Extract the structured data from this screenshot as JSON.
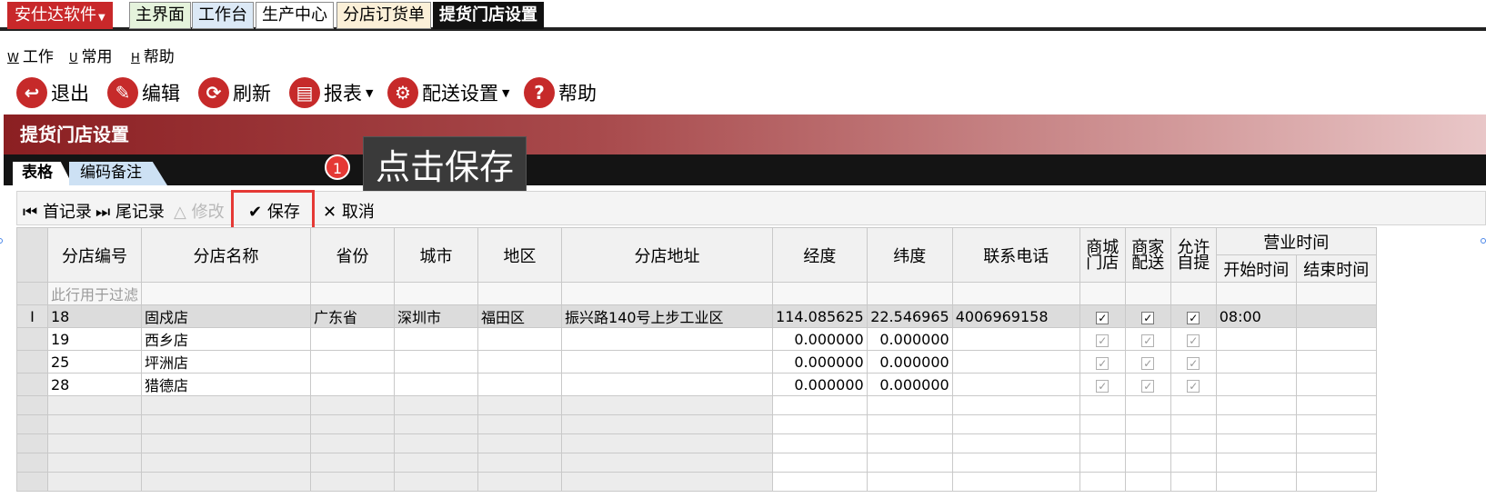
{
  "topbar": {
    "brand": "安仕达软件",
    "tabs": [
      "主界面",
      "工作台",
      "生产中心",
      "分店订货单",
      "提货门店设置"
    ]
  },
  "menubar": {
    "items": [
      {
        "key": "W",
        "label": "工作"
      },
      {
        "key": "U",
        "label": "常用"
      },
      {
        "key": "H",
        "label": "帮助"
      }
    ]
  },
  "toolbar": {
    "exit": "退出",
    "edit": "编辑",
    "refresh": "刷新",
    "report": "报表",
    "delivery": "配送设置",
    "help": "帮助"
  },
  "banner": {
    "title": "提货门店设置"
  },
  "subtabs": {
    "grid": "表格",
    "code_note": "编码备注"
  },
  "callout": {
    "badge": "1",
    "text": "点击保存"
  },
  "navbar": {
    "first": "首记录",
    "last": "尾记录",
    "modify": "修改",
    "save": "保存",
    "cancel": "取消"
  },
  "table": {
    "headers": {
      "code": "分店编号",
      "name": "分店名称",
      "province": "省份",
      "city": "城市",
      "district": "地区",
      "address": "分店地址",
      "lng": "经度",
      "lat": "纬度",
      "phone": "联系电话",
      "mall_a": "商城",
      "mall_b": "门店",
      "merchant_a": "商家",
      "merchant_b": "配送",
      "pickup_a": "允许",
      "pickup_b": "自提",
      "hours": "营业时间",
      "open": "开始时间",
      "close": "结束时间"
    },
    "filter_hint": "此行用于过滤",
    "rows": [
      {
        "code": "18",
        "name": "固戍店",
        "province": "广东省",
        "city": "深圳市",
        "district": "福田区",
        "address": "振兴路140号上步工业区",
        "lng": "114.085625",
        "lat": "22.546965",
        "phone": "4006969158",
        "open": "08:00",
        "close": ""
      },
      {
        "code": "19",
        "name": "西乡店",
        "province": "",
        "city": "",
        "district": "",
        "address": "",
        "lng": "0.000000",
        "lat": "0.000000",
        "phone": "",
        "open": "",
        "close": ""
      },
      {
        "code": "25",
        "name": "坪洲店",
        "province": "",
        "city": "",
        "district": "",
        "address": "",
        "lng": "0.000000",
        "lat": "0.000000",
        "phone": "",
        "open": "",
        "close": ""
      },
      {
        "code": "28",
        "name": "猎德店",
        "province": "",
        "city": "",
        "district": "",
        "address": "",
        "lng": "0.000000",
        "lat": "0.000000",
        "phone": "",
        "open": "",
        "close": ""
      }
    ],
    "row_marker": "I"
  }
}
